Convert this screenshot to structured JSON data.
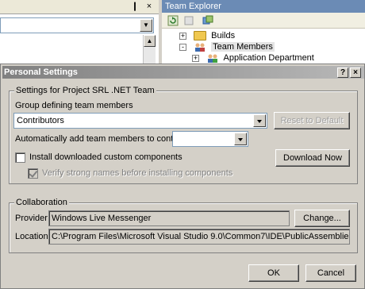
{
  "background": {
    "left_pane": {
      "controls": [
        "pin-icon",
        "close-icon"
      ]
    },
    "team_explorer": {
      "title": "Team Explorer",
      "toolbar": [
        "refresh-icon",
        "stop-icon",
        "add-project-icon"
      ],
      "tree": [
        {
          "label": "Builds",
          "expander": "+",
          "icon": "folder-icon"
        },
        {
          "label": "Team Members",
          "expander": "-",
          "icon": "team-members-icon",
          "selected": true
        },
        {
          "label": "Application Department",
          "expander": "+",
          "icon": "group-icon"
        }
      ]
    }
  },
  "dialog": {
    "title": "Personal Settings",
    "title_buttons": {
      "help": "?",
      "close": "×"
    },
    "settings_group": {
      "legend": "Settings for Project SRL .NET Team",
      "group_label": "Group defining team members",
      "group_value": "Contributors",
      "reset_label": "Reset to Default",
      "auto_add_label": "Automatically add team members to contact list:",
      "auto_add_value": "",
      "install_label": "Install downloaded custom components",
      "install_checked": false,
      "verify_label": "Verify strong names before installing components",
      "verify_checked": true,
      "download_label": "Download Now"
    },
    "collaboration_group": {
      "legend": "Collaboration",
      "provider_label": "Provider:",
      "provider_value": "Windows Live Messenger",
      "change_label": "Change...",
      "location_label": "Location:",
      "location_value": "C:\\Program Files\\Microsoft Visual Studio 9.0\\Common7\\IDE\\PublicAssemblies\\Collaboration"
    },
    "ok_label": "OK",
    "cancel_label": "Cancel"
  }
}
